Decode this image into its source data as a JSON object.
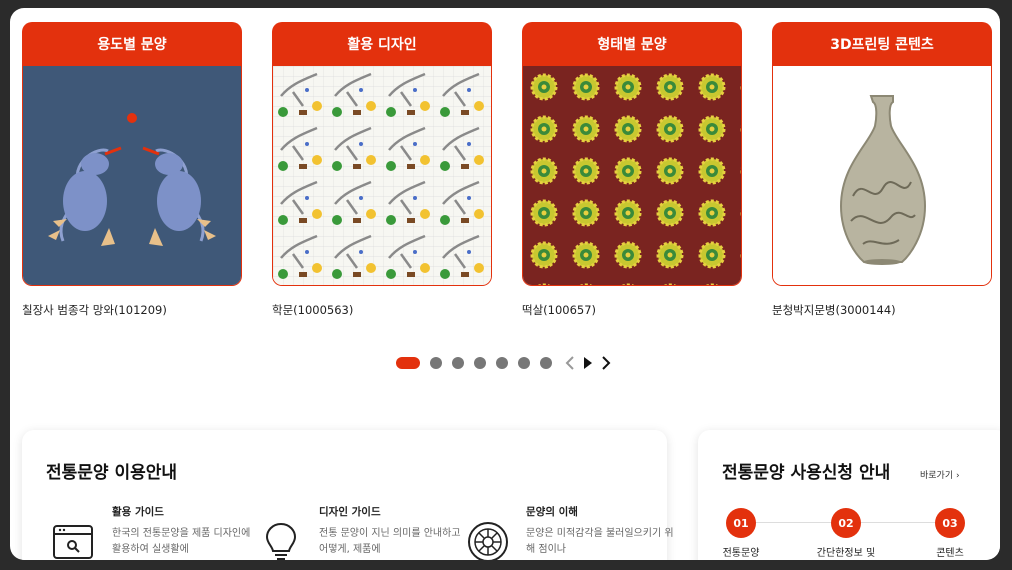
{
  "cards": [
    {
      "title": "용도별 문양",
      "caption": "칠장사 범종각 망와(101209)",
      "image": "dragon-pattern"
    },
    {
      "title": "활용 디자인",
      "caption": "학문(1000563)",
      "image": "crane-pattern"
    },
    {
      "title": "형태별 문양",
      "caption": "떡살(100657)",
      "image": "flower-pattern"
    },
    {
      "title": "3D프린팅 콘텐츠",
      "caption": "분청박지문병(3000144)",
      "image": "vase"
    }
  ],
  "pager": {
    "page_count": 7,
    "active_index": 0
  },
  "guide": {
    "title": "전통문양 이용안내",
    "items": [
      {
        "name": "활용 가이드",
        "desc": "한국의 전통문양을 제품 디자인에 활용하여 실생활에",
        "icon": "browser-search-icon"
      },
      {
        "name": "디자인 가이드",
        "desc": "전통 문양이 지닌 의미를 안내하고 어떻게, 제품에",
        "icon": "lightbulb-icon"
      },
      {
        "name": "문양의 이해",
        "desc": "문양은 미적감각을 불러일으키기 위해 점이나",
        "icon": "pattern-emblem-icon"
      }
    ]
  },
  "apply": {
    "title": "전통문양 사용신청 안내",
    "more": "바로가기",
    "steps": [
      {
        "num": "01",
        "label": "전통문양"
      },
      {
        "num": "02",
        "label": "간단한정보 및"
      },
      {
        "num": "03",
        "label": "콘텐츠"
      }
    ]
  },
  "colors": {
    "accent": "#e3310d",
    "dot": "#777777"
  }
}
